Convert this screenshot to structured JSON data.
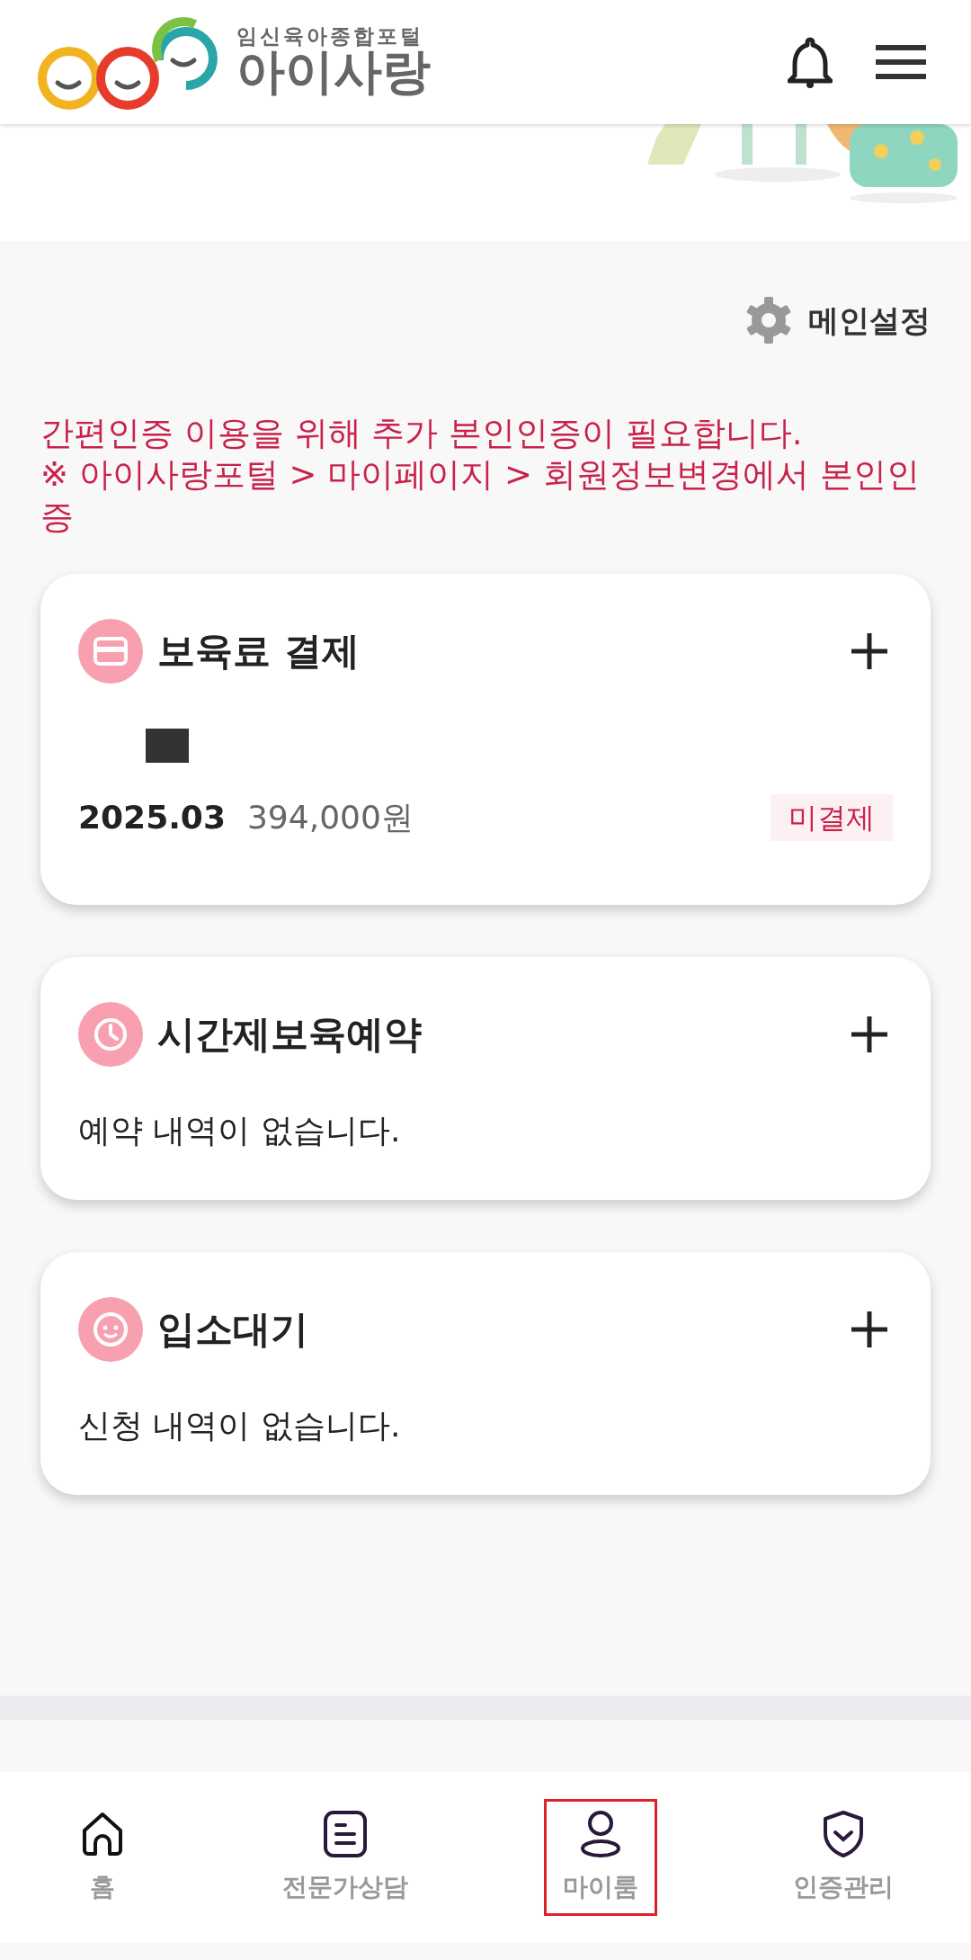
{
  "header": {
    "logo_subtitle": "임신육아종합포털",
    "logo_title": "아이사랑"
  },
  "main_settings": {
    "label": "메인설정"
  },
  "notice": {
    "lines": [
      "간편인증 이용을 위해 추가 본인인증이 필요합니다.",
      "※ 아이사랑포털 > 마이페이지 > 회원정보변경에서 본인인증"
    ]
  },
  "cards": [
    {
      "kind": "payment",
      "title": "보육료 결제",
      "month": "2025.03",
      "amount": "394,000원",
      "status": "미결제"
    },
    {
      "kind": "empty",
      "title": "시간제보육예약",
      "message": "예약 내역이 없습니다."
    },
    {
      "kind": "empty",
      "title": "입소대기",
      "message": "신청 내역이 없습니다."
    }
  ],
  "bottom_nav": [
    {
      "label": "홈",
      "selected": false
    },
    {
      "label": "전문가상담",
      "selected": false
    },
    {
      "label": "마이룸",
      "selected": true
    },
    {
      "label": "인증관리",
      "selected": false
    }
  ]
}
